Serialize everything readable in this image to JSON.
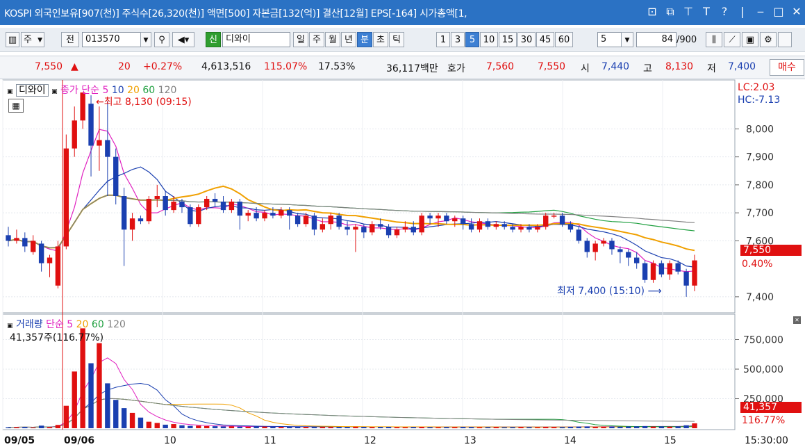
{
  "titlebar": {
    "title": "KOSPI 외국인보유[907(천)] 주식수[26,320(천)] 액면[500] 자본금[132(억)] 결산[12월] EPS[-164] 시가총액[1,"
  },
  "toolbar": {
    "market_select": "주",
    "jeon_button": "전",
    "code_input": "013570",
    "new_badge": "신",
    "stock_name": "디와이",
    "period_buttons": [
      "일",
      "주",
      "월",
      "년",
      "분",
      "초",
      "틱"
    ],
    "selected_period": "분",
    "interval_buttons": [
      "1",
      "3",
      "5",
      "10",
      "15",
      "30",
      "45",
      "60"
    ],
    "selected_interval": "5",
    "interval_select": "5",
    "count_value": "84",
    "count_total": "/900"
  },
  "quote": {
    "price": "7,550",
    "change_arrow": "▲",
    "change": "20",
    "change_pct": "+0.27%",
    "volume": "4,613,516",
    "volume_ratio": "115.07%",
    "turnover": "17.53%",
    "amount": "36,117백만",
    "bid_label": "호가",
    "bid1": "7,560",
    "bid2": "7,550",
    "open_label": "시",
    "open": "7,440",
    "high_label": "고",
    "high": "8,130",
    "low_label": "저",
    "low": "7,400",
    "buy_button": "매수"
  },
  "price_panel": {
    "name_tag": "디와이",
    "ma_label": "종가 단순 5",
    "ma_periods": [
      "10",
      "20",
      "60",
      "120"
    ],
    "high_annotation": "최고 8,130 (09:15)",
    "low_annotation": "최저 7,400 (15:10)",
    "lc_label": "LC:2.03",
    "hc_label": "HC:-7.13",
    "y_ticks": [
      "8,000",
      "7,900",
      "7,800",
      "7,700",
      "7,600",
      "7,400"
    ],
    "last_price_tag": "7,550",
    "last_pct": "0.40%"
  },
  "volume_panel": {
    "title": "거래량",
    "ma_label": "단순 5",
    "ma_periods": [
      "20",
      "60",
      "120"
    ],
    "current": "41,357주(116.77%)",
    "y_ticks": [
      "750,000",
      "500,000",
      "250,000"
    ],
    "last_volume_tag": "41,357",
    "last_pct": "116.77%"
  },
  "x_axis": {
    "labels": [
      "09/05",
      "09/06",
      "10",
      "11",
      "12",
      "13",
      "14",
      "15"
    ],
    "time_label": "15:30:00"
  },
  "colors": {
    "up": "#e01010",
    "down": "#1a3fb0",
    "ma5": "#e020c0",
    "ma10": "#1a3fb0",
    "ma20": "#f0a000",
    "ma60": "#20a040",
    "ma120": "#808080"
  },
  "chart_data": {
    "type": "candlestick",
    "interval_minutes": 5,
    "candles": [
      {
        "o": 7620,
        "c": 7600,
        "h": 7650,
        "l": 7580
      },
      {
        "o": 7600,
        "c": 7610,
        "h": 7640,
        "l": 7590
      },
      {
        "o": 7610,
        "c": 7580,
        "h": 7630,
        "l": 7560
      },
      {
        "o": 7560,
        "c": 7600,
        "h": 7620,
        "l": 7550
      },
      {
        "o": 7590,
        "c": 7520,
        "h": 7600,
        "l": 7490
      },
      {
        "o": 7520,
        "c": 7540,
        "h": 7550,
        "l": 7470
      },
      {
        "o": 7440,
        "c": 7580,
        "h": 7600,
        "l": 7430
      },
      {
        "o": 7580,
        "c": 7930,
        "h": 7980,
        "l": 7570
      },
      {
        "o": 7930,
        "c": 8030,
        "h": 8080,
        "l": 7900
      },
      {
        "o": 8030,
        "c": 8130,
        "h": 8130,
        "l": 8000
      },
      {
        "o": 8090,
        "c": 7940,
        "h": 8120,
        "l": 7830
      },
      {
        "o": 7940,
        "c": 7960,
        "h": 8080,
        "l": 7850
      },
      {
        "o": 7960,
        "c": 7900,
        "h": 8100,
        "l": 7760
      },
      {
        "o": 7900,
        "c": 7760,
        "h": 7930,
        "l": 7730
      },
      {
        "o": 7760,
        "c": 7640,
        "h": 7790,
        "l": 7510
      },
      {
        "o": 7640,
        "c": 7680,
        "h": 7700,
        "l": 7600
      },
      {
        "o": 7680,
        "c": 7670,
        "h": 7690,
        "l": 7660
      },
      {
        "o": 7670,
        "c": 7750,
        "h": 7760,
        "l": 7660
      },
      {
        "o": 7750,
        "c": 7760,
        "h": 7800,
        "l": 7720
      },
      {
        "o": 7760,
        "c": 7710,
        "h": 7780,
        "l": 7690
      },
      {
        "o": 7710,
        "c": 7740,
        "h": 7760,
        "l": 7700
      },
      {
        "o": 7740,
        "c": 7720,
        "h": 7750,
        "l": 7700
      },
      {
        "o": 7720,
        "c": 7660,
        "h": 7730,
        "l": 7650
      },
      {
        "o": 7660,
        "c": 7720,
        "h": 7730,
        "l": 7650
      },
      {
        "o": 7720,
        "c": 7750,
        "h": 7760,
        "l": 7710
      },
      {
        "o": 7750,
        "c": 7740,
        "h": 7770,
        "l": 7720
      },
      {
        "o": 7740,
        "c": 7710,
        "h": 7760,
        "l": 7700
      },
      {
        "o": 7710,
        "c": 7740,
        "h": 7750,
        "l": 7700
      },
      {
        "o": 7740,
        "c": 7690,
        "h": 7750,
        "l": 7640
      },
      {
        "o": 7690,
        "c": 7700,
        "h": 7710,
        "l": 7670
      },
      {
        "o": 7700,
        "c": 7680,
        "h": 7720,
        "l": 7670
      },
      {
        "o": 7680,
        "c": 7700,
        "h": 7710,
        "l": 7670
      },
      {
        "o": 7700,
        "c": 7690,
        "h": 7720,
        "l": 7680
      },
      {
        "o": 7690,
        "c": 7710,
        "h": 7720,
        "l": 7680
      },
      {
        "o": 7710,
        "c": 7690,
        "h": 7720,
        "l": 7640
      },
      {
        "o": 7690,
        "c": 7660,
        "h": 7700,
        "l": 7650
      },
      {
        "o": 7660,
        "c": 7690,
        "h": 7700,
        "l": 7650
      },
      {
        "o": 7690,
        "c": 7640,
        "h": 7700,
        "l": 7620
      },
      {
        "o": 7640,
        "c": 7660,
        "h": 7680,
        "l": 7630
      },
      {
        "o": 7660,
        "c": 7690,
        "h": 7700,
        "l": 7640
      },
      {
        "o": 7690,
        "c": 7650,
        "h": 7700,
        "l": 7640
      },
      {
        "o": 7650,
        "c": 7640,
        "h": 7670,
        "l": 7620
      },
      {
        "o": 7640,
        "c": 7650,
        "h": 7660,
        "l": 7560
      },
      {
        "o": 7650,
        "c": 7630,
        "h": 7660,
        "l": 7610
      },
      {
        "o": 7630,
        "c": 7660,
        "h": 7670,
        "l": 7620
      },
      {
        "o": 7660,
        "c": 7650,
        "h": 7680,
        "l": 7640
      },
      {
        "o": 7650,
        "c": 7620,
        "h": 7660,
        "l": 7610
      },
      {
        "o": 7620,
        "c": 7640,
        "h": 7650,
        "l": 7610
      },
      {
        "o": 7640,
        "c": 7650,
        "h": 7670,
        "l": 7630
      },
      {
        "o": 7650,
        "c": 7630,
        "h": 7670,
        "l": 7620
      },
      {
        "o": 7630,
        "c": 7690,
        "h": 7700,
        "l": 7620
      },
      {
        "o": 7690,
        "c": 7680,
        "h": 7700,
        "l": 7660
      },
      {
        "o": 7680,
        "c": 7690,
        "h": 7700,
        "l": 7650
      },
      {
        "o": 7690,
        "c": 7670,
        "h": 7700,
        "l": 7660
      },
      {
        "o": 7670,
        "c": 7680,
        "h": 7690,
        "l": 7650
      },
      {
        "o": 7680,
        "c": 7660,
        "h": 7690,
        "l": 7640
      },
      {
        "o": 7660,
        "c": 7640,
        "h": 7680,
        "l": 7630
      },
      {
        "o": 7640,
        "c": 7670,
        "h": 7680,
        "l": 7630
      },
      {
        "o": 7670,
        "c": 7650,
        "h": 7680,
        "l": 7640
      },
      {
        "o": 7650,
        "c": 7660,
        "h": 7670,
        "l": 7640
      },
      {
        "o": 7660,
        "c": 7650,
        "h": 7670,
        "l": 7640
      },
      {
        "o": 7650,
        "c": 7640,
        "h": 7660,
        "l": 7630
      },
      {
        "o": 7640,
        "c": 7650,
        "h": 7660,
        "l": 7630
      },
      {
        "o": 7650,
        "c": 7640,
        "h": 7660,
        "l": 7630
      },
      {
        "o": 7640,
        "c": 7650,
        "h": 7660,
        "l": 7630
      },
      {
        "o": 7650,
        "c": 7690,
        "h": 7700,
        "l": 7640
      },
      {
        "o": 7690,
        "c": 7690,
        "h": 7700,
        "l": 7680
      },
      {
        "o": 7690,
        "c": 7660,
        "h": 7700,
        "l": 7650
      },
      {
        "o": 7660,
        "c": 7640,
        "h": 7670,
        "l": 7630
      },
      {
        "o": 7640,
        "c": 7600,
        "h": 7650,
        "l": 7590
      },
      {
        "o": 7600,
        "c": 7560,
        "h": 7610,
        "l": 7540
      },
      {
        "o": 7560,
        "c": 7590,
        "h": 7600,
        "l": 7530
      },
      {
        "o": 7590,
        "c": 7600,
        "h": 7610,
        "l": 7580
      },
      {
        "o": 7600,
        "c": 7570,
        "h": 7610,
        "l": 7550
      },
      {
        "o": 7570,
        "c": 7560,
        "h": 7580,
        "l": 7520
      },
      {
        "o": 7560,
        "c": 7540,
        "h": 7570,
        "l": 7510
      },
      {
        "o": 7540,
        "c": 7520,
        "h": 7560,
        "l": 7500
      },
      {
        "o": 7520,
        "c": 7460,
        "h": 7530,
        "l": 7450
      },
      {
        "o": 7460,
        "c": 7520,
        "h": 7530,
        "l": 7450
      },
      {
        "o": 7520,
        "c": 7480,
        "h": 7530,
        "l": 7470
      },
      {
        "o": 7480,
        "c": 7520,
        "h": 7530,
        "l": 7460
      },
      {
        "o": 7520,
        "c": 7490,
        "h": 7530,
        "l": 7480
      },
      {
        "o": 7490,
        "c": 7440,
        "h": 7500,
        "l": 7400
      },
      {
        "o": 7440,
        "c": 7530,
        "h": 7550,
        "l": 7420
      }
    ],
    "volumes": [
      8000,
      9000,
      11000,
      6000,
      22000,
      10000,
      28000,
      190000,
      480000,
      845000,
      550000,
      720000,
      380000,
      240000,
      170000,
      130000,
      90000,
      55000,
      45000,
      30000,
      35000,
      25000,
      20000,
      22000,
      18000,
      17000,
      15000,
      16000,
      14000,
      13000,
      15000,
      14000,
      12000,
      11000,
      12000,
      13000,
      12000,
      14000,
      11000,
      10000,
      12000,
      11000,
      13000,
      12000,
      10000,
      11000,
      12000,
      10000,
      9000,
      11000,
      12000,
      10000,
      9000,
      11000,
      10000,
      12000,
      11000,
      9000,
      10000,
      11000,
      9000,
      10000,
      11000,
      10000,
      9000,
      12000,
      11000,
      10000,
      12000,
      14000,
      15000,
      12000,
      13000,
      14000,
      13000,
      15000,
      16000,
      18000,
      14000,
      15000,
      13000,
      16000,
      25000,
      41357
    ],
    "ylim_price": [
      7360,
      8160
    ],
    "ylim_volume": [
      0,
      900000
    ]
  }
}
